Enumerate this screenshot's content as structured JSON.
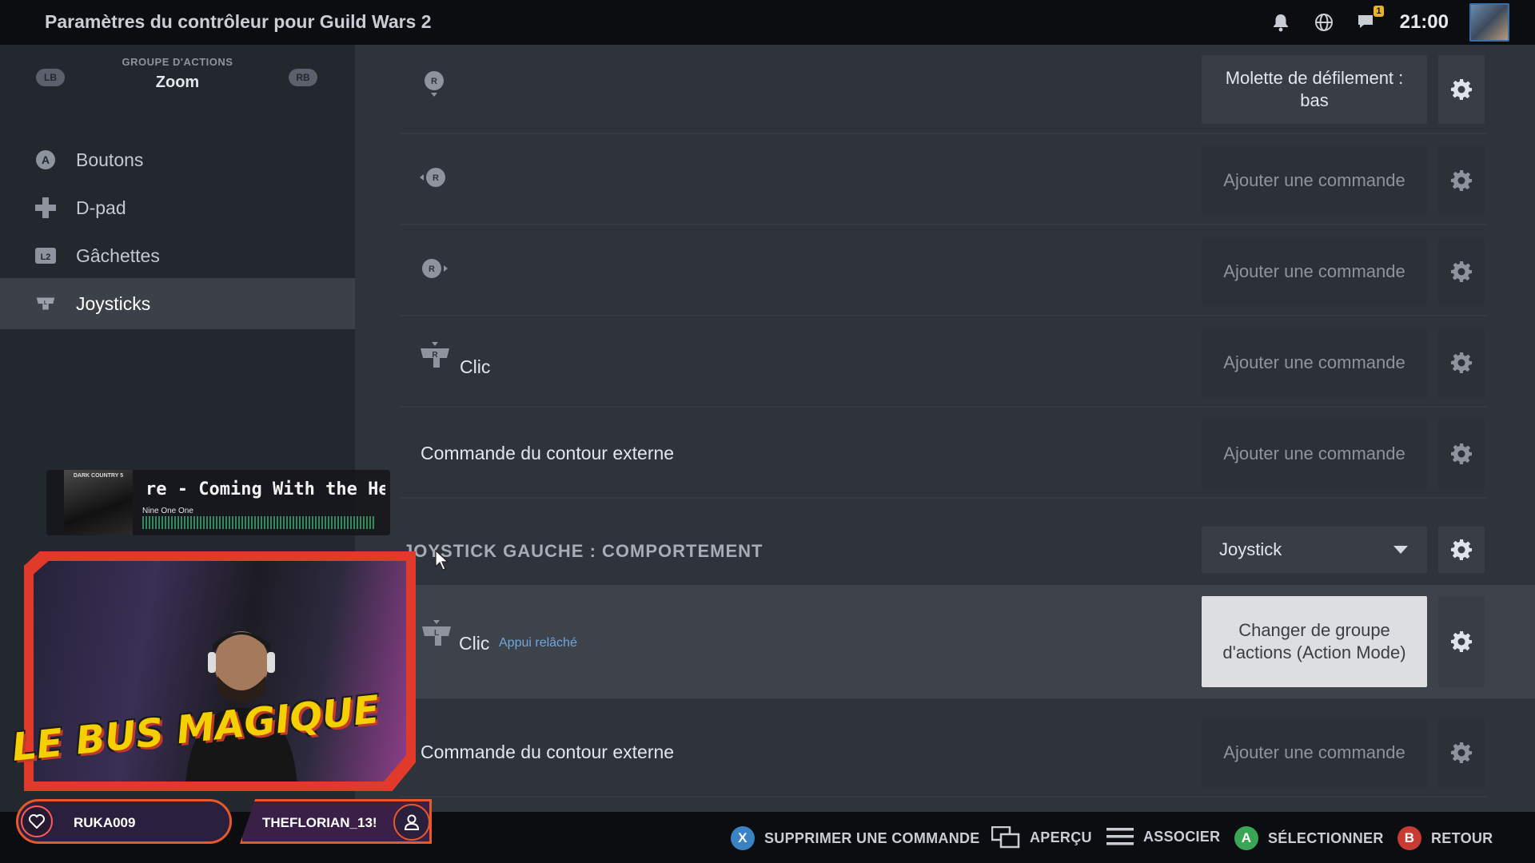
{
  "topbar": {
    "title": "Paramètres du contrôleur pour Guild Wars 2",
    "notification_count": "1",
    "clock": "21:00"
  },
  "sidebar": {
    "bumper_left": "LB",
    "bumper_right": "RB",
    "group_label": "GROUPE D'ACTIONS",
    "group_name": "Zoom",
    "items": [
      {
        "label": "Boutons",
        "icon": "a-button-icon"
      },
      {
        "label": "D-pad",
        "icon": "dpad-icon"
      },
      {
        "label": "Gâchettes",
        "icon": "l2-trigger-icon"
      },
      {
        "label": "Joysticks",
        "icon": "joystick-icon",
        "active": true
      }
    ]
  },
  "main": {
    "rows": [
      {
        "label": "",
        "icon": "right-stick-down-icon",
        "command": "Molette de défilement : bas"
      },
      {
        "label": "",
        "icon": "right-stick-left-icon",
        "command": "Ajouter une commande"
      },
      {
        "label": "",
        "icon": "right-stick-right-icon",
        "command": "Ajouter une commande"
      },
      {
        "label": "Clic",
        "icon": "right-stick-click-icon",
        "command": "Ajouter une commande"
      },
      {
        "label": "Commande du contour externe",
        "command": "Ajouter une commande"
      }
    ],
    "section": {
      "title": "JOYSTICK GAUCHE : COMPORTEMENT",
      "mode": "Joystick"
    },
    "left_rows": [
      {
        "label": "Clic",
        "sublabel": "Appui relâché",
        "icon": "left-stick-click-icon",
        "command": "Changer de groupe d'actions (Action Mode)"
      },
      {
        "label": "Commande du contour externe",
        "command": "Ajouter une commande"
      }
    ]
  },
  "bottombar": {
    "hints": [
      {
        "glyph": "X",
        "label": "SUPPRIMER UNE COMMANDE",
        "color": "#3b82c4"
      },
      {
        "glyph": "",
        "label": "APERÇU",
        "icon": "preview-icon"
      },
      {
        "glyph": "",
        "label": "ASSOCIER",
        "icon": "menu-icon"
      },
      {
        "glyph": "A",
        "label": "SÉLECTIONNER",
        "color": "#3aa655"
      },
      {
        "glyph": "B",
        "label": "RETOUR",
        "color": "#c83a32"
      }
    ]
  },
  "overlay": {
    "now_playing_title": "re - Coming With the Hellfi",
    "now_playing_artist": "Nine One One",
    "album_text": "DARK COUNTRY 5",
    "logo": "LE BUS MAGIQUE",
    "user_left": "RUKA009",
    "user_right": "THEFLORIAN_13!"
  }
}
